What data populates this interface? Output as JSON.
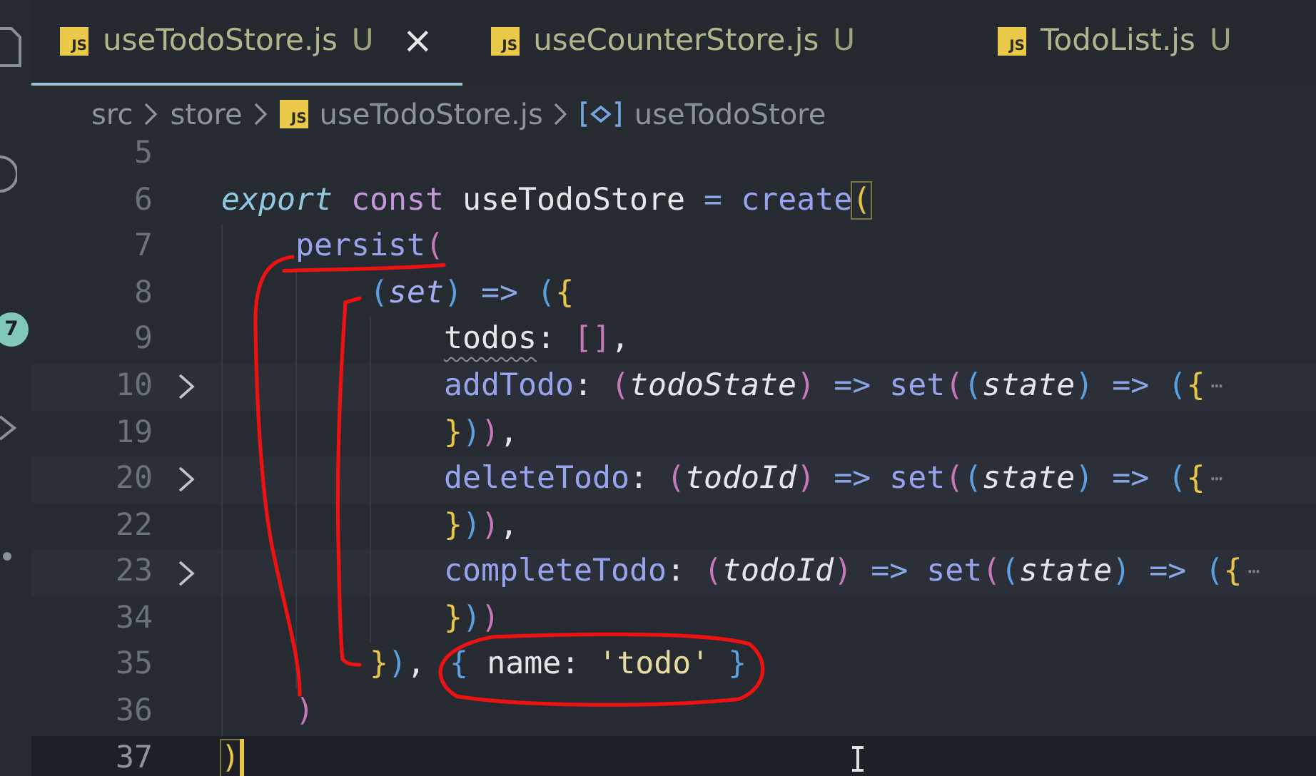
{
  "activity_bar": {
    "badge": "7"
  },
  "tabs": [
    {
      "icon_text": "JS",
      "label": "useTodoStore.js",
      "status": "U",
      "selected": true,
      "close": "×"
    },
    {
      "icon_text": "JS",
      "label": "useCounterStore.js",
      "status": "U",
      "selected": false
    },
    {
      "icon_text": "JS",
      "label": "TodoList.js",
      "status": "U",
      "selected": false
    }
  ],
  "breadcrumbs": [
    {
      "kind": "folder",
      "label": "src"
    },
    {
      "kind": "folder",
      "label": "store"
    },
    {
      "kind": "file",
      "icon_text": "JS",
      "label": "useTodoStore.js"
    },
    {
      "kind": "symbol",
      "label": "useTodoStore"
    }
  ],
  "lines": [
    {
      "number": "5",
      "folded": false,
      "current": false
    },
    {
      "number": "6",
      "folded": false,
      "current": false,
      "tokens": [
        {
          "kind": "keyword",
          "text": "export "
        },
        {
          "kind": "storage",
          "text": "const "
        },
        {
          "kind": "ident",
          "text": "useTodoStore "
        },
        {
          "kind": "operator",
          "text": "= "
        },
        {
          "kind": "function",
          "text": "create"
        },
        {
          "kind": "bracket-yellow",
          "text": "(",
          "matched": true
        }
      ],
      "children": [
        {
          "number": "7",
          "folded": false,
          "current": false,
          "tokens": [
            {
              "kind": "function",
              "text": "persist",
              "underlined": true
            },
            {
              "kind": "bracket-pink",
              "text": "(",
              "underlined": true
            }
          ],
          "children": [
            {
              "number": "8",
              "folded": false,
              "current": false,
              "tokens": [
                {
                  "kind": "bracket-blue",
                  "text": "("
                },
                {
                  "kind": "param-fn",
                  "text": "set"
                },
                {
                  "kind": "bracket-blue",
                  "text": ") "
                },
                {
                  "kind": "operator",
                  "text": "=> "
                },
                {
                  "kind": "bracket-blue",
                  "text": "("
                },
                {
                  "kind": "bracket-yellow",
                  "text": "{"
                }
              ],
              "children": [
                {
                  "number": "9",
                  "folded": false,
                  "current": false,
                  "tokens": [
                    {
                      "kind": "ident",
                      "text": "todos",
                      "squiggle": true
                    },
                    {
                      "kind": "punct",
                      "text": ": "
                    },
                    {
                      "kind": "bracket-pink",
                      "text": "[]"
                    },
                    {
                      "kind": "punct",
                      "text": ","
                    }
                  ]
                },
                {
                  "number": "10",
                  "folded": true,
                  "current": false,
                  "tokens": [
                    {
                      "kind": "function",
                      "text": "addTodo"
                    },
                    {
                      "kind": "punct",
                      "text": ": "
                    },
                    {
                      "kind": "bracket-pink",
                      "text": "("
                    },
                    {
                      "kind": "param",
                      "text": "todoState"
                    },
                    {
                      "kind": "bracket-pink",
                      "text": ") "
                    },
                    {
                      "kind": "operator",
                      "text": "=> "
                    },
                    {
                      "kind": "function",
                      "text": "set"
                    },
                    {
                      "kind": "bracket-pink",
                      "text": "("
                    },
                    {
                      "kind": "bracket-blue",
                      "text": "("
                    },
                    {
                      "kind": "param",
                      "text": "state"
                    },
                    {
                      "kind": "bracket-blue",
                      "text": ") "
                    },
                    {
                      "kind": "operator",
                      "text": "=> "
                    },
                    {
                      "kind": "bracket-blue",
                      "text": "("
                    },
                    {
                      "kind": "bracket-yellow",
                      "text": "{"
                    },
                    {
                      "kind": "ellipsis",
                      "text": "⋯"
                    }
                  ]
                },
                {
                  "number": "19",
                  "folded": false,
                  "current": false,
                  "tokens": [
                    {
                      "kind": "bracket-yellow",
                      "text": "}"
                    },
                    {
                      "kind": "bracket-blue",
                      "text": ")"
                    },
                    {
                      "kind": "bracket-pink",
                      "text": ")"
                    },
                    {
                      "kind": "punct",
                      "text": ","
                    }
                  ]
                },
                {
                  "number": "20",
                  "folded": true,
                  "current": false,
                  "tokens": [
                    {
                      "kind": "function",
                      "text": "deleteTodo"
                    },
                    {
                      "kind": "punct",
                      "text": ": "
                    },
                    {
                      "kind": "bracket-pink",
                      "text": "("
                    },
                    {
                      "kind": "param",
                      "text": "todoId"
                    },
                    {
                      "kind": "bracket-pink",
                      "text": ") "
                    },
                    {
                      "kind": "operator",
                      "text": "=> "
                    },
                    {
                      "kind": "function",
                      "text": "set"
                    },
                    {
                      "kind": "bracket-pink",
                      "text": "("
                    },
                    {
                      "kind": "bracket-blue",
                      "text": "("
                    },
                    {
                      "kind": "param",
                      "text": "state"
                    },
                    {
                      "kind": "bracket-blue",
                      "text": ") "
                    },
                    {
                      "kind": "operator",
                      "text": "=> "
                    },
                    {
                      "kind": "bracket-blue",
                      "text": "("
                    },
                    {
                      "kind": "bracket-yellow",
                      "text": "{"
                    },
                    {
                      "kind": "ellipsis",
                      "text": "⋯"
                    }
                  ]
                },
                {
                  "number": "22",
                  "folded": false,
                  "current": false,
                  "tokens": [
                    {
                      "kind": "bracket-yellow",
                      "text": "}"
                    },
                    {
                      "kind": "bracket-blue",
                      "text": ")"
                    },
                    {
                      "kind": "bracket-pink",
                      "text": ")"
                    },
                    {
                      "kind": "punct",
                      "text": ","
                    }
                  ]
                },
                {
                  "number": "23",
                  "folded": true,
                  "current": false,
                  "tokens": [
                    {
                      "kind": "function",
                      "text": "completeTodo"
                    },
                    {
                      "kind": "punct",
                      "text": ": "
                    },
                    {
                      "kind": "bracket-pink",
                      "text": "("
                    },
                    {
                      "kind": "param",
                      "text": "todoId"
                    },
                    {
                      "kind": "bracket-pink",
                      "text": ") "
                    },
                    {
                      "kind": "operator",
                      "text": "=> "
                    },
                    {
                      "kind": "function",
                      "text": "set"
                    },
                    {
                      "kind": "bracket-pink",
                      "text": "("
                    },
                    {
                      "kind": "bracket-blue",
                      "text": "("
                    },
                    {
                      "kind": "param",
                      "text": "state"
                    },
                    {
                      "kind": "bracket-blue",
                      "text": ") "
                    },
                    {
                      "kind": "operator",
                      "text": "=> "
                    },
                    {
                      "kind": "bracket-blue",
                      "text": "("
                    },
                    {
                      "kind": "bracket-yellow",
                      "text": "{"
                    },
                    {
                      "kind": "ellipsis",
                      "text": "⋯"
                    }
                  ]
                },
                {
                  "number": "34",
                  "folded": false,
                  "current": false,
                  "tokens": [
                    {
                      "kind": "bracket-yellow",
                      "text": "}"
                    },
                    {
                      "kind": "bracket-blue",
                      "text": ")"
                    },
                    {
                      "kind": "bracket-pink",
                      "text": ")"
                    }
                  ]
                }
              ]
            },
            {
              "number": "35",
              "folded": false,
              "current": false,
              "tokens": [
                {
                  "kind": "bracket-yellow",
                  "text": "}"
                },
                {
                  "kind": "bracket-blue",
                  "text": ")"
                },
                {
                  "kind": "punct",
                  "text": ", "
                },
                {
                  "kind": "bracket-blue",
                  "text": "{ ",
                  "circled": true
                },
                {
                  "kind": "ident",
                  "text": "name",
                  "circled": true
                },
                {
                  "kind": "punct",
                  "text": ": ",
                  "circled": true
                },
                {
                  "kind": "string",
                  "text": "'todo' ",
                  "circled": true
                },
                {
                  "kind": "bracket-blue",
                  "text": "}",
                  "circled": true
                }
              ]
            }
          ]
        },
        {
          "number": "36",
          "folded": false,
          "current": false,
          "tokens": [
            {
              "kind": "bracket-pink",
              "text": ")"
            }
          ]
        }
      ]
    },
    {
      "number": "37",
      "folded": false,
      "current": true,
      "tokens": [
        {
          "kind": "bracket-yellow",
          "text": ")",
          "matched": true
        }
      ]
    }
  ]
}
